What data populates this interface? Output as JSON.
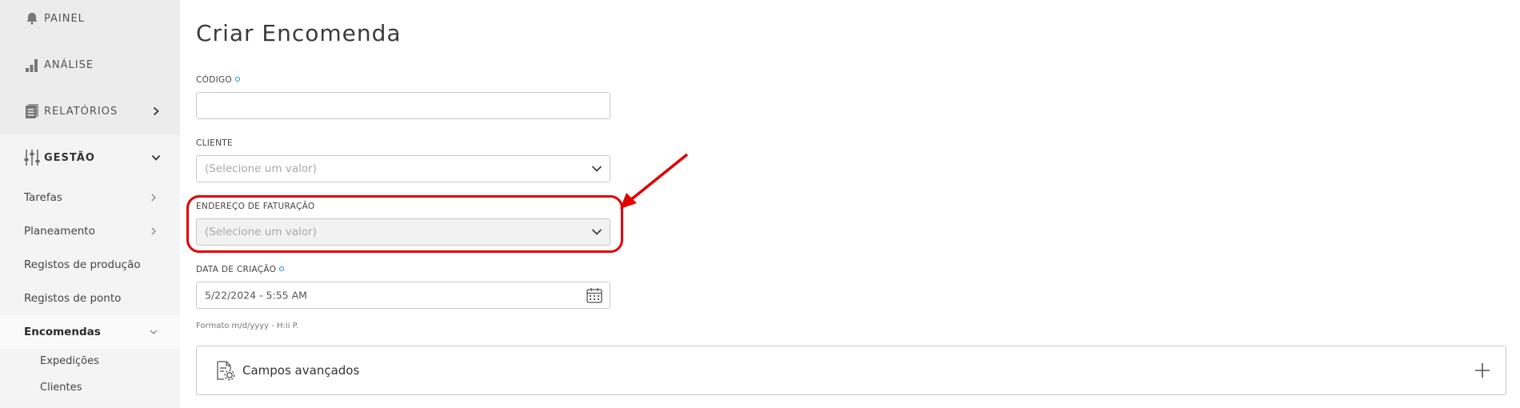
{
  "sidebar": {
    "main_items": [
      {
        "label": "PAINEL",
        "icon": "bell-icon"
      },
      {
        "label": "ANÁLISE",
        "icon": "bar-chart-icon"
      },
      {
        "label": "RELATÓRIOS",
        "icon": "reports-icon"
      },
      {
        "label": "GESTÃO",
        "icon": "sliders-icon"
      }
    ],
    "sub_items": [
      {
        "label": "Tarefas"
      },
      {
        "label": "Planeamento"
      },
      {
        "label": "Registos de produção"
      },
      {
        "label": "Registos de ponto"
      },
      {
        "label": "Encomendas"
      }
    ],
    "subsub_items": [
      {
        "label": "Expedições"
      },
      {
        "label": "Clientes"
      }
    ]
  },
  "main": {
    "title": "Criar Encomenda",
    "code": {
      "label": "CÓDIGO",
      "value": ""
    },
    "client": {
      "label": "CLIENTE",
      "placeholder": "(Selecione um valor)"
    },
    "billing_address": {
      "label": "ENDEREÇO DE FATURAÇÃO",
      "placeholder": "(Selecione um valor)"
    },
    "creation_date": {
      "label": "DATA DE CRIAÇÃO",
      "value": "5/22/2024 - 5:55 AM",
      "format_hint": "Formato m/d/yyyy - H:ii P."
    },
    "advanced": {
      "label": "Campos avançados"
    }
  },
  "colors": {
    "accent": "#1a8fd6",
    "annotation": "#e00000",
    "sidebar_bg": "#f4f4f4",
    "sidebar_top_bg": "#ececec"
  }
}
